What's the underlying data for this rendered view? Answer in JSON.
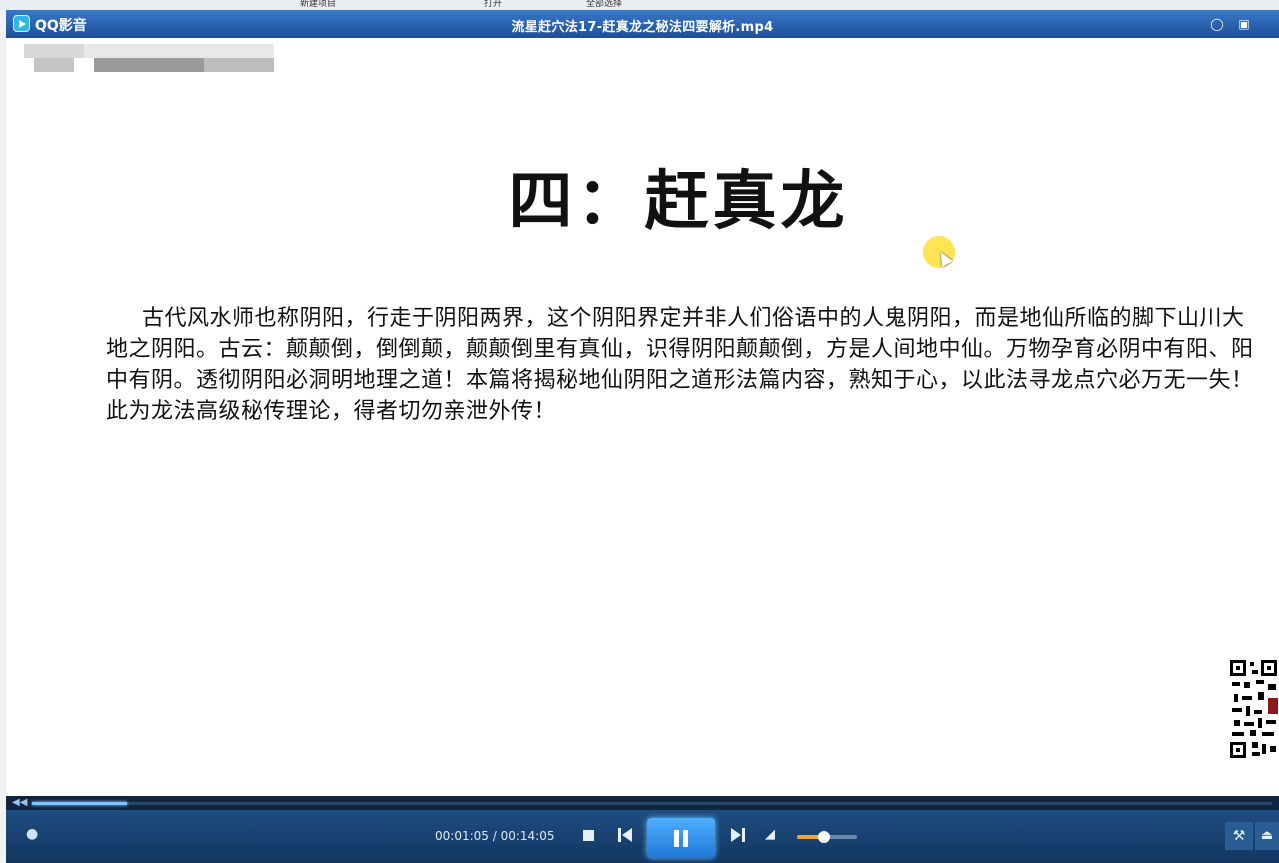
{
  "window": {
    "app_name": "QQ影音",
    "file_title": "流星赶穴法17-赶真龙之秘法四要解析.mp4"
  },
  "slide": {
    "title": "四：赶真龙",
    "body": "古代风水师也称阴阳，行走于阴阳两界，这个阴阳界定并非人们俗语中的人鬼阴阳，而是地仙所临的脚下山川大地之阴阳。古云：颠颠倒，倒倒颠，颠颠倒里有真仙，识得阴阳颠颠倒，方是人间地中仙。万物孕育必阴中有阳、阳中有阴。透彻阴阳必洞明地理之道！本篇将揭秘地仙阴阳之道形法篇内容，熟知于心，以此法寻龙点穴必万无一失！此为龙法高级秘传理论，得者切勿亲泄外传！"
  },
  "playback": {
    "current_time": "00:01:05",
    "separator": " / ",
    "total_time": "00:14:05",
    "progress": 0.077,
    "volume": 0.45
  },
  "background_taskbar": {
    "items": [
      "新建项目",
      "打开",
      "全部选择"
    ]
  },
  "icons": {
    "app": "qq-player-logo-icon",
    "feedback": "speech-bubble-icon",
    "mini_mode": "mini-mode-icon",
    "footprint": "footprint-icon",
    "stop": "stop-icon",
    "prev": "previous-icon",
    "pause": "pause-icon",
    "next": "next-icon",
    "volume": "speaker-icon",
    "settings": "wrench-icon",
    "eject": "eject-icon"
  },
  "colors": {
    "titlebar": "#2a62b0",
    "controlbar": "#1a4272",
    "accent": "#4fb0ff",
    "volume": "#f5a623",
    "cursor_highlight": "#ffdd28"
  }
}
